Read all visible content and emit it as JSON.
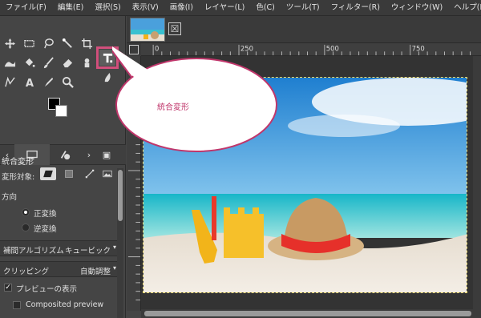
{
  "menu": [
    "ファイル(F)",
    "編集(E)",
    "選択(S)",
    "表示(V)",
    "画像(I)",
    "レイヤー(L)",
    "色(C)",
    "ツール(T)",
    "フィルター(R)",
    "ウィンドウ(W)",
    "ヘルプ(H)"
  ],
  "callout": {
    "text": "統合変形"
  },
  "tool_options": {
    "title": "統合変形",
    "transform_target_label": "変形対象:",
    "direction_label": "方向",
    "direction_options": [
      "正変換",
      "逆変換"
    ],
    "interpolation_label": "補間アルゴリズム",
    "interpolation_value": "キュービック",
    "clipping_label": "クリッピング",
    "clipping_value": "自動調整",
    "preview_label": "プレビューの表示",
    "composited_label": "Composited preview"
  },
  "ruler": {
    "marks": [
      "0",
      "250",
      "500",
      "750"
    ]
  },
  "colors": {
    "accent": "#d14f7c",
    "callout_text": "#c0366b",
    "selection": "#e8d56a"
  },
  "icons": {
    "tools": [
      "move-icon",
      "rect-select-icon",
      "lasso-icon",
      "fuzzy-select-icon",
      "crop-icon",
      "unified-transform-icon",
      "warp-icon",
      "bucket-fill-icon",
      "paintbrush-icon",
      "eraser-icon",
      "clone-icon",
      "smudge-icon",
      "paths-icon",
      "text-icon",
      "color-picker-icon",
      "zoom-icon"
    ]
  }
}
